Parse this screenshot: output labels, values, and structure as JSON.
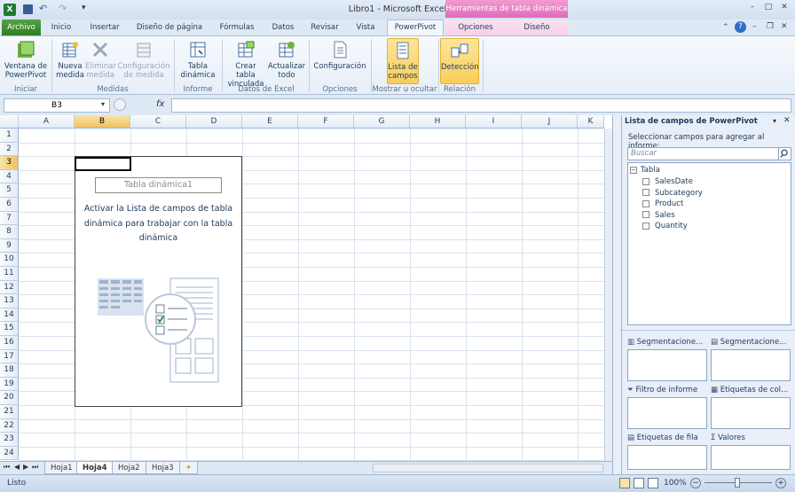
{
  "window": {
    "title": "Libro1 - Microsoft Excel",
    "context_tab_header": "Herramientas de tabla dinámica"
  },
  "tabs": [
    "Archivo",
    "Inicio",
    "Insertar",
    "Diseño de página",
    "Fórmulas",
    "Datos",
    "Revisar",
    "Vista",
    "PowerPivot",
    "Opciones",
    "Diseño"
  ],
  "ribbon": {
    "buttons": [
      {
        "label": "Ventana de PowerPivot",
        "state": "normal"
      },
      {
        "label": "Nueva medida",
        "state": "normal"
      },
      {
        "label": "Eliminar medida",
        "state": "disabled"
      },
      {
        "label": "Configuración de medida",
        "state": "disabled"
      },
      {
        "label": "Tabla dinámica",
        "state": "normal"
      },
      {
        "label": "Crear tabla vinculada",
        "state": "normal"
      },
      {
        "label": "Actualizar todo",
        "state": "normal"
      },
      {
        "label": "Configuración",
        "state": "normal"
      },
      {
        "label": "Lista de campos",
        "state": "active"
      },
      {
        "label": "Detección",
        "state": "active"
      }
    ],
    "groups": [
      "Iniciar",
      "Medidas",
      "Informe",
      "Datos de Excel",
      "Opciones",
      "Mostrar u ocultar",
      "Relación"
    ]
  },
  "formula_bar": {
    "name_box": "B3",
    "fx": "fx",
    "value": ""
  },
  "sheet": {
    "columns": [
      "A",
      "B",
      "C",
      "D",
      "E",
      "F",
      "G",
      "H",
      "I",
      "J",
      "K"
    ],
    "selected_column": "B",
    "selected_row": 3,
    "rows": [
      "1",
      "2",
      "3",
      "4",
      "5",
      "6",
      "7",
      "8",
      "9",
      "10",
      "11",
      "12",
      "13",
      "14",
      "15",
      "16",
      "17",
      "18",
      "19",
      "20",
      "21",
      "22",
      "23",
      "24"
    ],
    "pivot": {
      "name": "Tabla dinámica1",
      "message": "Activar la Lista de campos de tabla dinámica para trabajar con la tabla dinámica"
    },
    "tabs": [
      "Hoja1",
      "Hoja4",
      "Hoja2",
      "Hoja3"
    ],
    "active_tab": "Hoja4"
  },
  "field_list": {
    "title": "Lista de campos de PowerPivot",
    "subtitle": "Seleccionar campos para agregar al informe:",
    "search_placeholder": "Buscar",
    "table": "Tabla",
    "fields": [
      "SalesDate",
      "Subcategory",
      "Product",
      "Sales",
      "Quantity"
    ],
    "areas": [
      "Segmentacione...",
      "Segmentacione...",
      "Filtro de informe",
      "Etiquetas de col...",
      "Etiquetas de fila",
      "Valores"
    ]
  },
  "status": {
    "text": "Listo",
    "zoom": "100%"
  },
  "colors": {
    "accent": "#2e7d23",
    "context": "#e06ab8",
    "highlight": "#f8cd5b"
  }
}
